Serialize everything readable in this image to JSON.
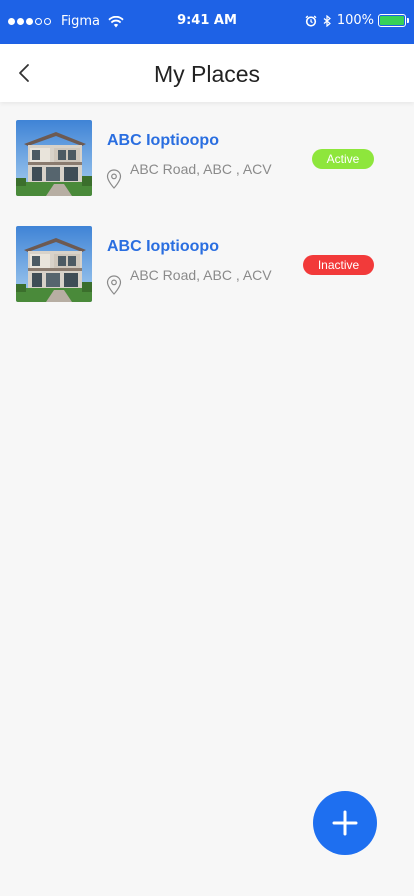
{
  "status_bar": {
    "carrier": "Figma",
    "time": "9:41 AM",
    "battery": "100%",
    "icons": [
      "signal-dots-icon",
      "wifi-icon",
      "alarm-icon",
      "bluetooth-icon",
      "battery-icon"
    ]
  },
  "header": {
    "title": "My Places",
    "back_icon": "chevron-left-icon"
  },
  "places": [
    {
      "name": "ABC Ioptioopo",
      "address": "ABC Road, ABC , ACV",
      "status": "Active",
      "status_color": "#8ee63c",
      "image": "house-thumbnail"
    },
    {
      "name": "ABC Ioptioopo",
      "address": "ABC Road, ABC , ACV",
      "status": "Inactive",
      "status_color": "#f23a3a",
      "image": "house-thumbnail"
    }
  ],
  "fab": {
    "icon": "plus-icon",
    "color": "#1e6ff0"
  },
  "colors": {
    "status_bar_bg": "#1e62e6",
    "accent": "#2a6ee0",
    "page_bg": "#f7f7f7"
  }
}
